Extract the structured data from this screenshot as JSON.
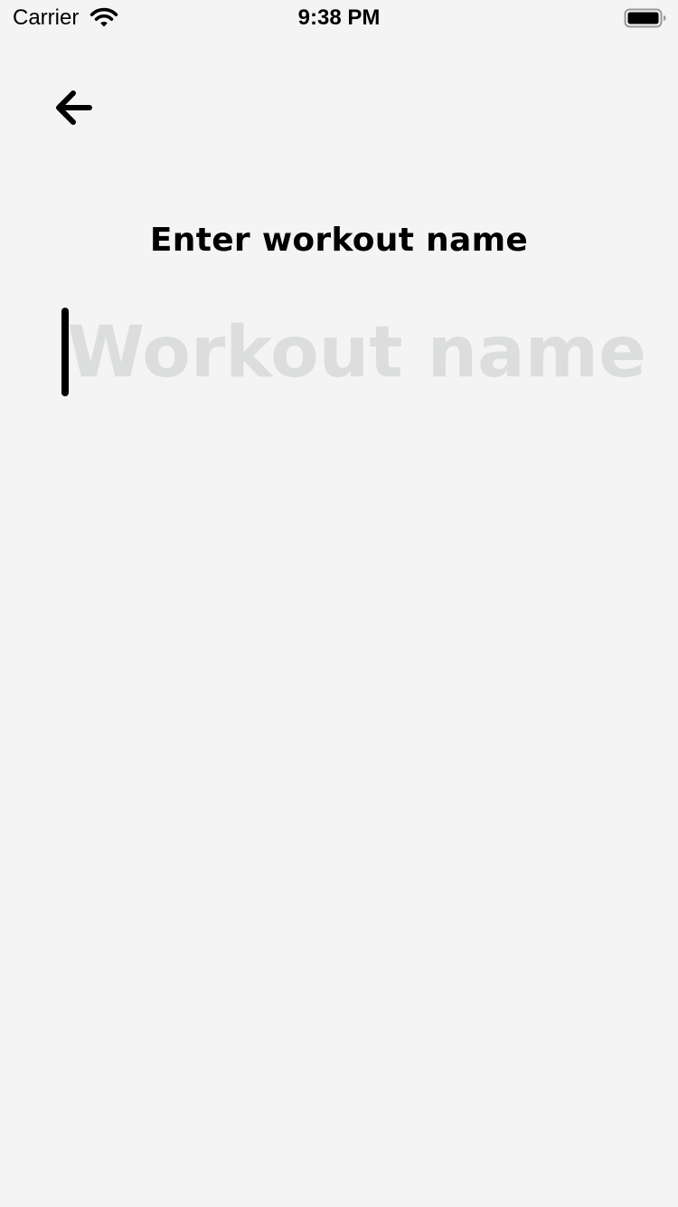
{
  "status_bar": {
    "carrier": "Carrier",
    "time": "9:38 PM",
    "wifi_icon": "wifi-icon",
    "battery_icon": "battery-icon"
  },
  "nav": {
    "back_icon": "arrow-left-icon"
  },
  "form": {
    "title": "Enter workout name",
    "input_value": "",
    "input_placeholder": "Workout name"
  },
  "colors": {
    "background": "#f4f4f4",
    "text": "#000000",
    "placeholder": "#dcdddd"
  }
}
